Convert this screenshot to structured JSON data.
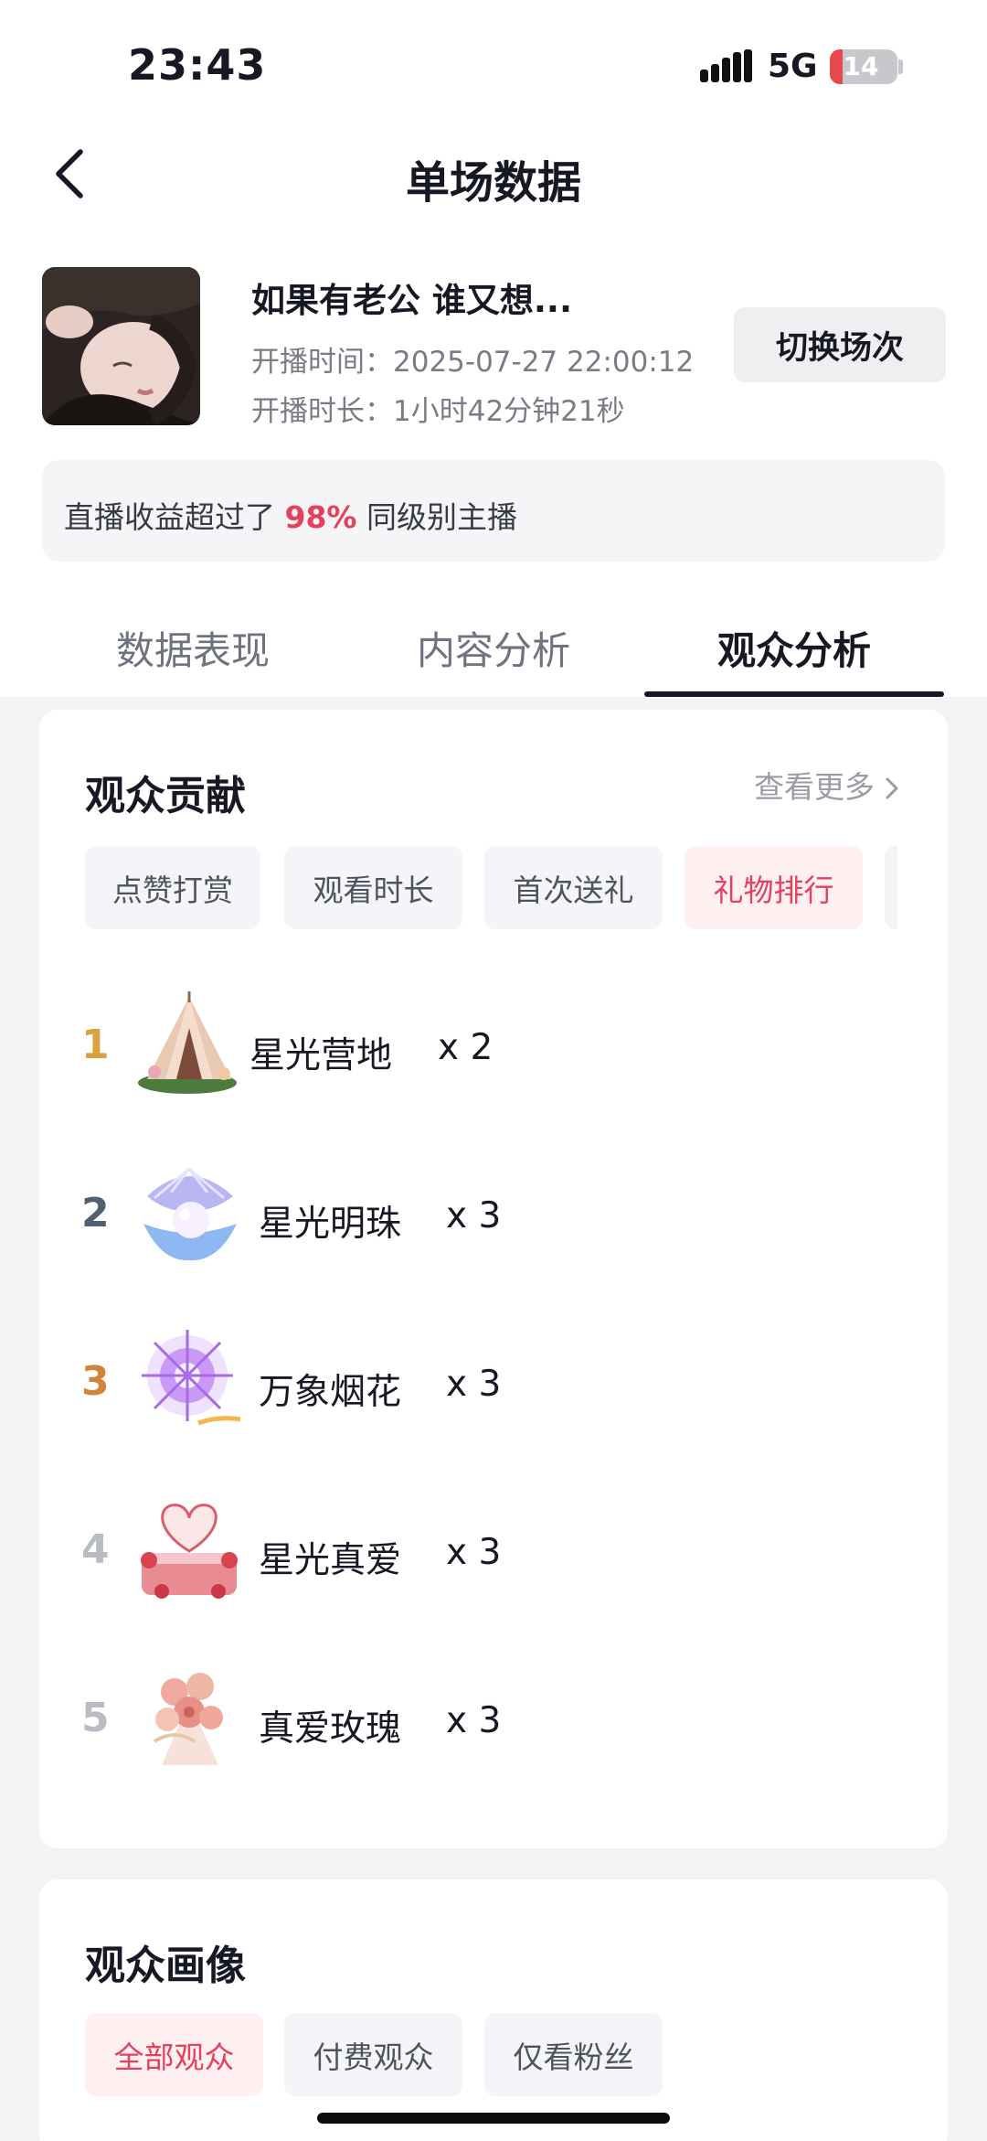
{
  "status_bar": {
    "time": "23:43",
    "network": "5G",
    "battery": "14"
  },
  "header": {
    "title": "单场数据"
  },
  "session": {
    "title": "如果有老公 谁又想...",
    "start_label": "开播时间：",
    "start_time": "2025-07-27 22:00:12",
    "duration_label": "开播时长：",
    "duration": "1小时42分钟21秒",
    "switch_button": "切换场次"
  },
  "earnings": {
    "prefix": "直播收益超过了",
    "percent": "98%",
    "suffix": "同级别主播"
  },
  "tabs": [
    {
      "label": "数据表现",
      "active": false
    },
    {
      "label": "内容分析",
      "active": false
    },
    {
      "label": "观众分析",
      "active": true
    }
  ],
  "contribution": {
    "title": "观众贡献",
    "see_more": "查看更多",
    "filters": [
      {
        "label": "点赞打赏",
        "active": false
      },
      {
        "label": "观看时长",
        "active": false
      },
      {
        "label": "首次送礼",
        "active": false
      },
      {
        "label": "礼物排行",
        "active": true
      }
    ],
    "ranking": [
      {
        "rank": "1",
        "gift": "星光营地",
        "count": "x 2",
        "icon": "glamping-tent-gift-icon"
      },
      {
        "rank": "2",
        "gift": "星光明珠",
        "count": "x 3",
        "icon": "pearl-shell-gift-icon"
      },
      {
        "rank": "3",
        "gift": "万象烟花",
        "count": "x 3",
        "icon": "firework-gift-icon"
      },
      {
        "rank": "4",
        "gift": "星光真爱",
        "count": "x 3",
        "icon": "heart-cake-gift-icon"
      },
      {
        "rank": "5",
        "gift": "真爱玫瑰",
        "count": "x 3",
        "icon": "rose-bouquet-gift-icon"
      }
    ],
    "colors": {
      "rank1": "#d9a23c",
      "rank2": "#4f6170",
      "rank3": "#d3843a",
      "rank_other": "#b9bcc3",
      "accent": "#e5415d"
    }
  },
  "portrait": {
    "title": "观众画像",
    "filters": [
      {
        "label": "全部观众",
        "active": true
      },
      {
        "label": "付费观众",
        "active": false
      },
      {
        "label": "仅看粉丝",
        "active": false
      }
    ]
  }
}
